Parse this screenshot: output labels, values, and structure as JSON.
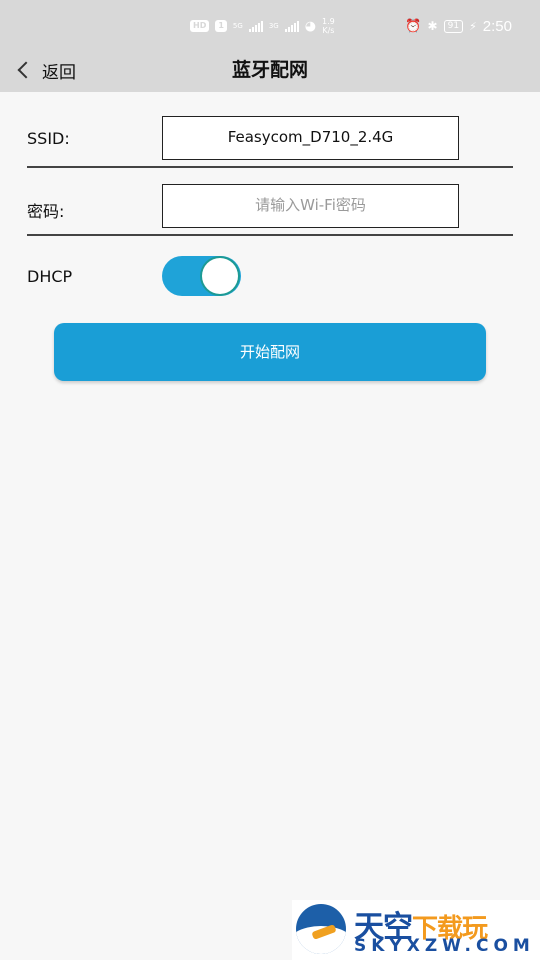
{
  "status_bar": {
    "hd_badge": "HD",
    "sim1": "1",
    "net1": "5G",
    "net2": "3G",
    "speed_value": "1.9",
    "speed_unit": "K/s",
    "battery": "91",
    "time": "2:50"
  },
  "header": {
    "back_label": "返回",
    "title": "蓝牙配网"
  },
  "form": {
    "ssid_label": "SSID:",
    "ssid_value": "Feasycom_D710_2.4G",
    "password_label": "密码:",
    "password_placeholder": "请输入Wi-Fi密码",
    "dhcp_label": "DHCP",
    "dhcp_enabled": true
  },
  "actions": {
    "start_label": "开始配网"
  },
  "watermark": {
    "line1_blue": "天空",
    "line1_orange": "下载玩",
    "line2": "SKYXZW.COM"
  },
  "colors": {
    "accent": "#1a9ed6",
    "header_bg": "#d8d8d8",
    "background": "#f7f7f7"
  }
}
